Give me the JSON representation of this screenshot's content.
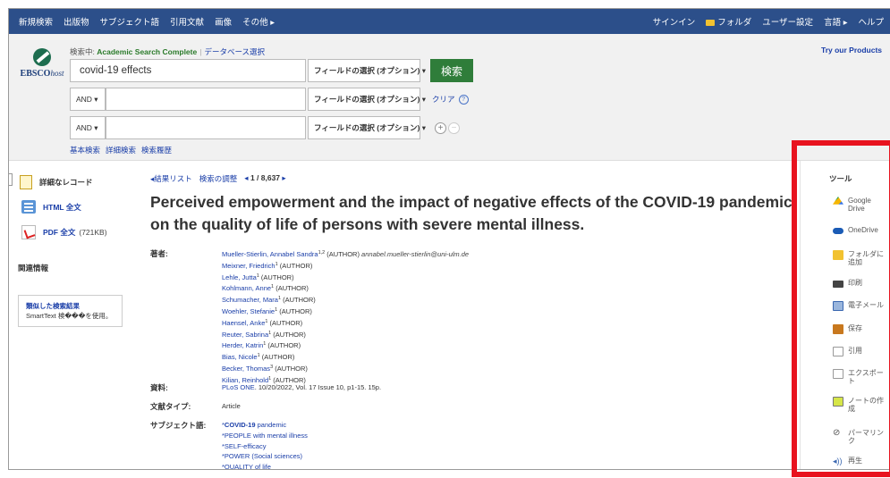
{
  "topnav": {
    "left": [
      "新規検索",
      "出版物",
      "サブジェクト語",
      "引用文献",
      "画像",
      "その他 ▸"
    ],
    "signin": "サインイン",
    "folder": "フォルダ",
    "user_settings": "ユーザー設定",
    "language": "言語 ▸",
    "help": "ヘルプ"
  },
  "search": {
    "logo_text": "EBSCO",
    "logo_host": "host",
    "searching_label": "検索中:",
    "database": "Academic Search Complete",
    "choose_db": "データベース選択",
    "query1": "covid-19 effects",
    "bool2": "AND ▾",
    "bool3": "AND ▾",
    "field_label": "フィールドの選択 (オプション) ▾",
    "search_button": "検索",
    "clear": "クリア",
    "help_glyph": "?",
    "plus": "+",
    "minus": "−",
    "basic": "基本検索",
    "advanced": "詳細検索",
    "history": "検索履歴",
    "try_products": "Try our Products"
  },
  "left": {
    "detailed_record": "詳細なレコード",
    "html_fulltext": "HTML 全文",
    "pdf_fulltext": "PDF 全文",
    "pdf_size": "(721KB)",
    "related": "関連情報",
    "smart_title": "類似した検索結果",
    "smart_text": "SmartText 検���を使用。"
  },
  "main": {
    "result_list": "◂結果リスト",
    "refine": "検索の調整",
    "counter_prev": "◂",
    "counter": "1 / 8,637",
    "counter_next": "▸",
    "title": "Perceived empowerment and the impact of negative effects of the COVID-19 pandemic on the quality of life of persons with severe mental illness.",
    "authors_label": "著者:",
    "authors": [
      {
        "name": "Mueller-Stierlin, Annabel Sandra",
        "sup": "1,2",
        "role": "(AUTHOR)",
        "email": "annabel.mueller-stierlin@uni-ulm.de"
      },
      {
        "name": "Meixner, Friedrich",
        "sup": "1",
        "role": "(AUTHOR)"
      },
      {
        "name": "Lehle, Jutta",
        "sup": "1",
        "role": "(AUTHOR)"
      },
      {
        "name": "Kohlmann, Anne",
        "sup": "1",
        "role": "(AUTHOR)"
      },
      {
        "name": "Schumacher, Mara",
        "sup": "1",
        "role": "(AUTHOR)"
      },
      {
        "name": "Woehler, Stefanie",
        "sup": "1",
        "role": "(AUTHOR)"
      },
      {
        "name": "Haensel, Anke",
        "sup": "1",
        "role": "(AUTHOR)"
      },
      {
        "name": "Reuter, Sabrina",
        "sup": "1",
        "role": "(AUTHOR)"
      },
      {
        "name": "Herder, Katrin",
        "sup": "1",
        "role": "(AUTHOR)"
      },
      {
        "name": "Bias, Nicole",
        "sup": "1",
        "role": "(AUTHOR)"
      },
      {
        "name": "Becker, Thomas",
        "sup": "3",
        "role": "(AUTHOR)"
      },
      {
        "name": "Kilian, Reinhold",
        "sup": "1",
        "role": "(AUTHOR)"
      }
    ],
    "source_label": "資料:",
    "source_link": "PLoS ONE",
    "source_rest": ". 10/20/2022, Vol. 17 Issue 10, p1-15. 15p.",
    "doctype_label": "文献タイプ:",
    "doctype": "Article",
    "subjects_label": "サブジェクト語:",
    "subjects": [
      {
        "bold": "COVID-19",
        "rest": " pandemic"
      },
      {
        "bold": "",
        "rest": "PEOPLE with mental illness"
      },
      {
        "bold": "",
        "rest": "SELF-efficacy"
      },
      {
        "bold": "",
        "rest": "POWER (Social sciences)"
      },
      {
        "bold": "",
        "rest": "QUALITY of life"
      }
    ]
  },
  "tools": {
    "title": "ツール",
    "collapse": "»",
    "items": [
      {
        "icon": "google-drive-icon",
        "label": "Google Drive"
      },
      {
        "icon": "onedrive-icon",
        "label": "OneDrive"
      },
      {
        "icon": "folder-icon",
        "label": "フォルダに追加"
      },
      {
        "icon": "print-icon",
        "label": "印刷"
      },
      {
        "icon": "email-icon",
        "label": "電子メール"
      },
      {
        "icon": "save-icon",
        "label": "保存"
      },
      {
        "icon": "cite-icon",
        "label": "引用"
      },
      {
        "icon": "export-icon",
        "label": "エクスポート"
      },
      {
        "icon": "note-icon",
        "label": "ノートの作成"
      },
      {
        "icon": "permalink-icon",
        "label": "パーマリンク"
      },
      {
        "icon": "listen-icon",
        "label": "再生"
      }
    ]
  },
  "colors": {
    "nav": "#2c4f8a",
    "search_button": "#2f7d3a",
    "highlight": "#e8131f"
  }
}
